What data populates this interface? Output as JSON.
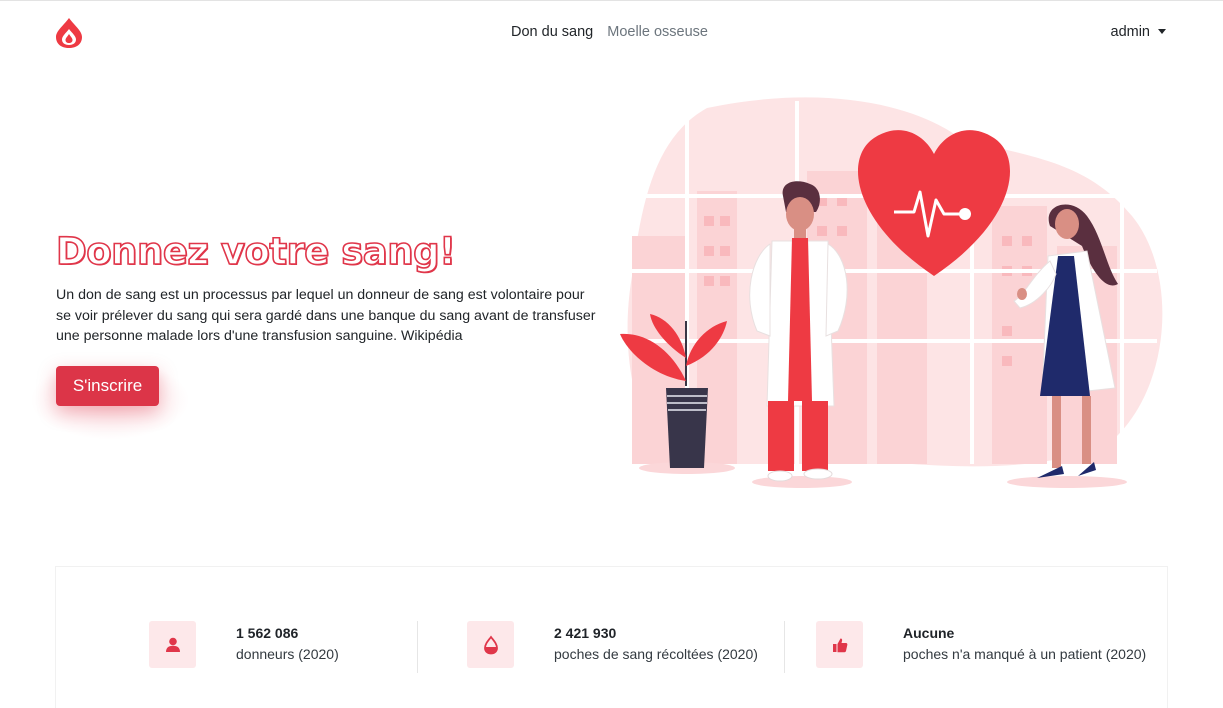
{
  "nav": {
    "links": [
      {
        "label": "Don du sang",
        "active": true
      },
      {
        "label": "Moelle osseuse",
        "active": false
      }
    ],
    "user": "admin"
  },
  "hero": {
    "title": "Donnez votre sang!",
    "description": "Un don de sang est un processus par lequel un donneur de sang est volontaire pour se voir prélever du sang qui sera gardé dans une banque du sang avant de transfuser une personne malade lors d'une transfusion sanguine. Wikipédia",
    "cta_label": "S'inscrire"
  },
  "stats": [
    {
      "icon": "person-icon",
      "value": "1 562 086",
      "label": "donneurs (2020)"
    },
    {
      "icon": "blood-bag-icon",
      "value": "2 421 930",
      "label": "poches de sang récoltées (2020)"
    },
    {
      "icon": "thumbs-up-icon",
      "value": "Aucune",
      "label": "poches n'a manqué à un patient (2020)"
    }
  ],
  "colors": {
    "brand": "#dc3548",
    "brand_light": "#fde8ea",
    "text": "#212529",
    "muted": "#6c757d"
  }
}
